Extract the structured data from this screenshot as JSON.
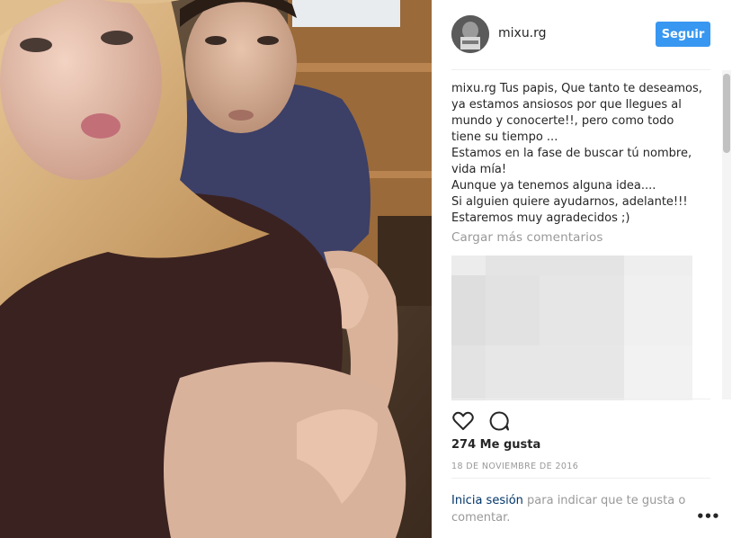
{
  "post": {
    "username": "mixu.rg",
    "follow_label": "Seguir",
    "caption_author": "mixu.rg",
    "caption_text": " Tus papis, Que tanto te deseamos, ya estamos ansiosos por que llegues al mundo y conocerte!!, pero como todo tiene su tiempo ...\nEstamos en la fase de buscar tú nombre, vida mía!\nAunque ya tenemos alguna idea....\nSi alguien quiere ayudarnos, adelante!!!\nEstaremos muy agradecidos ;)",
    "load_more_label": "Cargar más comentarios",
    "likes_label": "274 Me gusta",
    "date_label": "18 DE NOVIEMBRE DE 2016",
    "login_link": "Inicia sesión",
    "login_rest": " para indicar que te gusta o comentar.",
    "more_label": "•••"
  },
  "icons": {
    "like": "heart-icon",
    "comment": "comment-icon",
    "more": "more-options-icon"
  },
  "colors": {
    "accent": "#3897f0",
    "link": "#003569",
    "muted": "#999999",
    "text": "#262626"
  }
}
